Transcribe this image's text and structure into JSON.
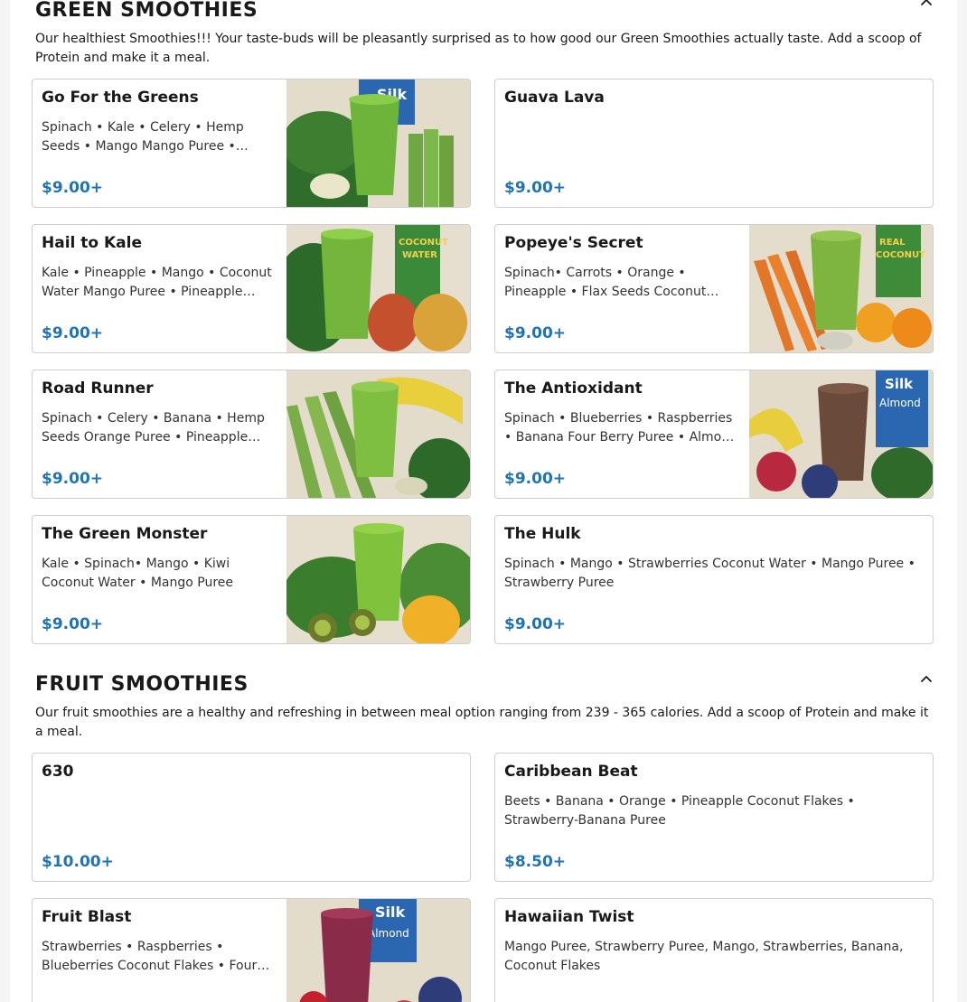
{
  "sections": [
    {
      "title": "GREEN SMOOTHIES",
      "description": "Our healthiest Smoothies!!! Your taste-buds will be pleasantly surprised as to how good our Green Smoothies actually taste. Add a scoop of Protein and make it a meal.",
      "items": [
        {
          "name": "Go For the Greens",
          "description": "Spinach • Kale • Celery • Hemp Seeds • Mango Mango Puree • Pineapple Puree",
          "price": "$9.00+",
          "has_photo": true
        },
        {
          "name": "Guava Lava",
          "description": "",
          "price": "$9.00+",
          "has_photo": false
        },
        {
          "name": "Hail to Kale",
          "description": "Kale • Pineapple • Mango • Coconut Water Mango Puree • Pineapple Puree",
          "price": "$9.00+",
          "has_photo": true
        },
        {
          "name": "Popeye's Secret",
          "description": "Spinach• Carrots • Orange • Pineapple • Flax Seeds Coconut Water • Orange Juice",
          "price": "$9.00+",
          "has_photo": true
        },
        {
          "name": "Road Runner",
          "description": "Spinach • Celery • Banana • Hemp Seeds Orange Puree • Pineapple Puree",
          "price": "$9.00+",
          "has_photo": true
        },
        {
          "name": "The Antioxidant",
          "description": "Spinach • Blueberries • Raspberries • Banana Four Berry Puree • Almond Milk",
          "price": "$9.00+",
          "has_photo": true
        },
        {
          "name": "The Green Monster",
          "description": "Kale • Spinach• Mango • Kiwi Coconut Water • Mango Puree",
          "price": "$9.00+",
          "has_photo": true
        },
        {
          "name": "The Hulk",
          "description": "Spinach • Mango • Strawberries Coconut Water • Mango Puree • Strawberry Puree",
          "price": "$9.00+",
          "has_photo": false
        }
      ]
    },
    {
      "title": "FRUIT SMOOTHIES",
      "description": "Our fruit smoothies are a healthy and refreshing in between meal option ranging from 239 - 365 calories. Add a scoop of Protein and make it a meal.",
      "items": [
        {
          "name": "630",
          "description": "",
          "price": "$10.00+",
          "has_photo": false
        },
        {
          "name": "Caribbean Beat",
          "description": "Beets • Banana • Orange • Pineapple Coconut Flakes • Strawberry-Banana Puree",
          "price": "$8.50+",
          "has_photo": false
        },
        {
          "name": "Fruit Blast",
          "description": "Strawberries • Raspberries • Blueberries Coconut Flakes • Four Berry Puree",
          "price": "",
          "has_photo": true
        },
        {
          "name": "Hawaiian Twist",
          "description": "Mango Puree, Strawberry Puree, Mango, Strawberries, Banana, Coconut Flakes",
          "price": "",
          "has_photo": false
        }
      ]
    }
  ],
  "icons": {
    "collapse": "chevron-up-icon"
  },
  "colors": {
    "price": "#1f74b8",
    "border": "#cfcfcf"
  }
}
